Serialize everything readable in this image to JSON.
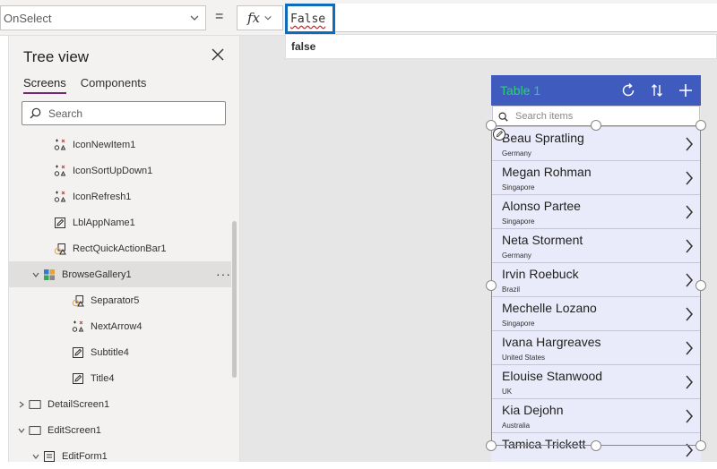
{
  "formula_bar": {
    "property": "OnSelect",
    "equals": "=",
    "fx_label": "fx",
    "value": "False",
    "suggestion": "false"
  },
  "tree_view": {
    "title": "Tree view",
    "tabs": [
      {
        "label": "Screens",
        "active": true
      },
      {
        "label": "Components",
        "active": false
      }
    ],
    "search_placeholder": "Search",
    "items": [
      {
        "label": "IconNewItem1",
        "icon": "icon-control-icon",
        "indent": 2
      },
      {
        "label": "IconSortUpDown1",
        "icon": "icon-control-icon",
        "indent": 2
      },
      {
        "label": "IconRefresh1",
        "icon": "icon-control-icon",
        "indent": 2
      },
      {
        "label": "LblAppName1",
        "icon": "label-control-icon",
        "indent": 2
      },
      {
        "label": "RectQuickActionBar1",
        "icon": "shape-control-icon",
        "indent": 2
      },
      {
        "label": "BrowseGallery1",
        "icon": "gallery-control-icon",
        "indent": 1,
        "selected": true,
        "expanded": true
      },
      {
        "label": "Separator5",
        "icon": "shape-control-icon",
        "indent": 3
      },
      {
        "label": "NextArrow4",
        "icon": "icon-control-icon",
        "indent": 3
      },
      {
        "label": "Subtitle4",
        "icon": "label-control-icon",
        "indent": 3
      },
      {
        "label": "Title4",
        "icon": "label-control-icon",
        "indent": 3
      },
      {
        "label": "DetailScreen1",
        "icon": "screen-icon",
        "indent": 0,
        "expanded": false
      },
      {
        "label": "EditScreen1",
        "icon": "screen-icon",
        "indent": 0,
        "expanded": true
      },
      {
        "label": "EditForm1",
        "icon": "form-control-icon",
        "indent": 1,
        "expanded": true
      }
    ]
  },
  "app": {
    "title": "Table 1",
    "search_placeholder": "Search items",
    "colors": {
      "header": "#3e5bbd",
      "title": "#2bd175",
      "body": "#e9ebfb"
    },
    "gallery": [
      {
        "name": "Beau Spratling",
        "country": "Germany"
      },
      {
        "name": "Megan Rohman",
        "country": "Singapore"
      },
      {
        "name": "Alonso Partee",
        "country": "Singapore"
      },
      {
        "name": "Neta Storment",
        "country": "Germany"
      },
      {
        "name": "Irvin Roebuck",
        "country": "Brazil"
      },
      {
        "name": "Mechelle Lozano",
        "country": "Singapore"
      },
      {
        "name": "Ivana Hargreaves",
        "country": "United States"
      },
      {
        "name": "Elouise Stanwood",
        "country": "UK"
      },
      {
        "name": "Kia Dejohn",
        "country": "Australia"
      },
      {
        "name": "Tamica Trickett",
        "country": ""
      }
    ]
  }
}
